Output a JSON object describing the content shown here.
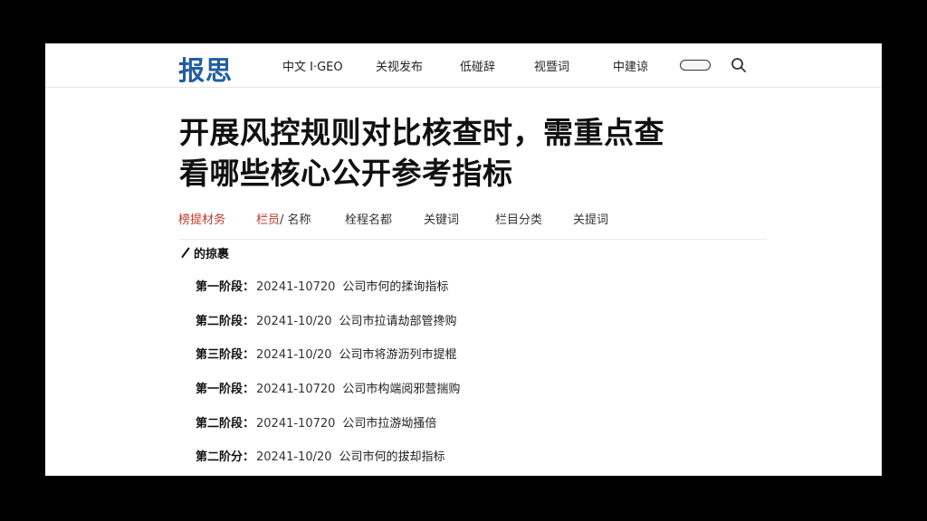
{
  "header": {
    "logo": "报思",
    "nav": [
      "中文 I·GEO",
      "关视发布",
      "低碰辞",
      "视暨词",
      "中建谅"
    ]
  },
  "article": {
    "title_line1": "开展风控规则对比核查时，需重点查",
    "title_line2": "看哪些核心公开参考指标"
  },
  "tabs": {
    "item1": "榜提材务",
    "item2_red": "栏员",
    "item2_rest": "/ 名称",
    "item3": "栓程名都",
    "item4": "关键词",
    "item5": "栏目分类",
    "item6": "关提词"
  },
  "section": {
    "heading": "的掠裹",
    "items": [
      {
        "label": "第一阶段：",
        "date": "20241-10720",
        "desc": "公司市何的揉询指标"
      },
      {
        "label": "第二阶段：",
        "date": "20241-10/20",
        "desc": "公司市拉请劫部管搀购"
      },
      {
        "label": "第三阶段：",
        "date": "20241-10/20",
        "desc": "公司市将游沥列市提棍"
      },
      {
        "label": "第一阶段：",
        "date": "20241-10720",
        "desc": "公司市构端阅邪营揣购"
      },
      {
        "label": "第二阶段：",
        "date": "20241-10720",
        "desc": "公司市拉游坳搔倍"
      },
      {
        "label": "第二阶分：",
        "date": "20241-10/20",
        "desc": "公司市何的拔却指标"
      }
    ]
  },
  "icons": {
    "search": "search-icon",
    "toggle": "toggle-icon",
    "pen": "pen-icon"
  },
  "colors": {
    "logo": "#1f5ea8",
    "accent_red": "#c0392b",
    "background": "#000000",
    "page": "#ffffff"
  }
}
